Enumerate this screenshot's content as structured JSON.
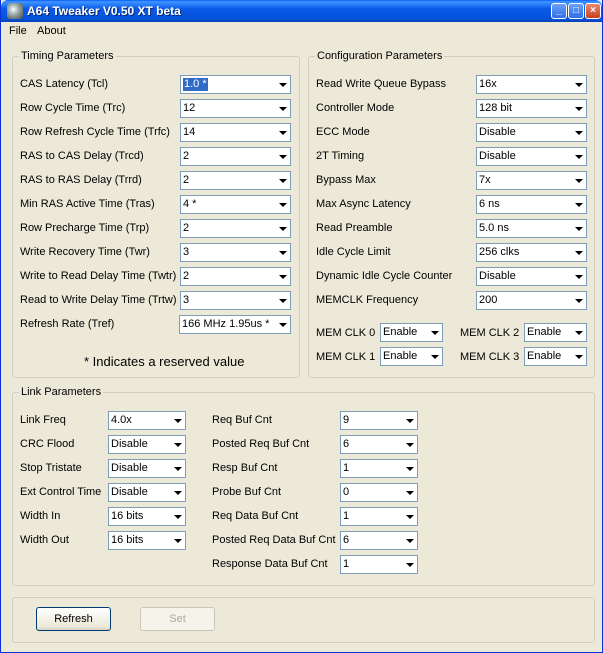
{
  "window": {
    "title": "A64 Tweaker V0.50 XT beta",
    "minimize": "_",
    "maximize": "□",
    "close": "×"
  },
  "menu": {
    "file": "File",
    "about": "About"
  },
  "timing": {
    "legend": "Timing Parameters",
    "rows": [
      {
        "label": "CAS Latency (Tcl)",
        "value": "1.0 *"
      },
      {
        "label": "Row Cycle Time (Trc)",
        "value": "12"
      },
      {
        "label": "Row Refresh Cycle Time (Trfc)",
        "value": "14"
      },
      {
        "label": "RAS to CAS Delay (Trcd)",
        "value": "2"
      },
      {
        "label": "RAS to RAS Delay (Trrd)",
        "value": "2"
      },
      {
        "label": "Min RAS Active Time (Tras)",
        "value": "4 *"
      },
      {
        "label": "Row Precharge Time (Trp)",
        "value": "2"
      },
      {
        "label": "Write Recovery Time (Twr)",
        "value": "3"
      },
      {
        "label": "Write to Read Delay Time (Twtr)",
        "value": "2"
      },
      {
        "label": "Read to Write Delay Time (Trtw)",
        "value": "3"
      },
      {
        "label": "Refresh Rate (Tref)",
        "value": "166 MHz 1.95us *"
      }
    ],
    "note": "* Indicates a reserved value"
  },
  "config": {
    "legend": "Configuration Parameters",
    "rows": [
      {
        "label": "Read Write Queue Bypass",
        "value": "16x"
      },
      {
        "label": "Controller Mode",
        "value": "128 bit"
      },
      {
        "label": "ECC Mode",
        "value": "Disable"
      },
      {
        "label": "2T Timing",
        "value": "Disable"
      },
      {
        "label": "Bypass Max",
        "value": "7x"
      },
      {
        "label": "Max Async Latency",
        "value": "6 ns"
      },
      {
        "label": "Read Preamble",
        "value": "5.0 ns"
      },
      {
        "label": "Idle Cycle Limit",
        "value": "256 clks"
      },
      {
        "label": "Dynamic Idle Cycle Counter",
        "value": "Disable"
      },
      {
        "label": "MEMCLK Frequency",
        "value": "200"
      }
    ],
    "memclk": [
      {
        "label": "MEM CLK 0",
        "value": "Enable"
      },
      {
        "label": "MEM CLK 2",
        "value": "Enable"
      },
      {
        "label": "MEM CLK 1",
        "value": "Enable"
      },
      {
        "label": "MEM CLK 3",
        "value": "Enable"
      }
    ]
  },
  "link": {
    "legend": "Link Parameters",
    "left": [
      {
        "label": "Link Freq",
        "value": "4.0x"
      },
      {
        "label": "CRC Flood",
        "value": "Disable"
      },
      {
        "label": "Stop Tristate",
        "value": "Disable"
      },
      {
        "label": "Ext Control Time",
        "value": "Disable"
      },
      {
        "label": "Width In",
        "value": "16 bits"
      },
      {
        "label": "Width Out",
        "value": "16 bits"
      }
    ],
    "right": [
      {
        "label": "Req Buf Cnt",
        "value": "9"
      },
      {
        "label": "Posted Req Buf Cnt",
        "value": "6"
      },
      {
        "label": "Resp Buf Cnt",
        "value": "1"
      },
      {
        "label": "Probe Buf Cnt",
        "value": "0"
      },
      {
        "label": "Req Data Buf Cnt",
        "value": "1"
      },
      {
        "label": "Posted Req Data Buf Cnt",
        "value": "6"
      },
      {
        "label": "Response Data Buf Cnt",
        "value": "1"
      }
    ]
  },
  "buttons": {
    "refresh": "Refresh",
    "set": "Set"
  }
}
